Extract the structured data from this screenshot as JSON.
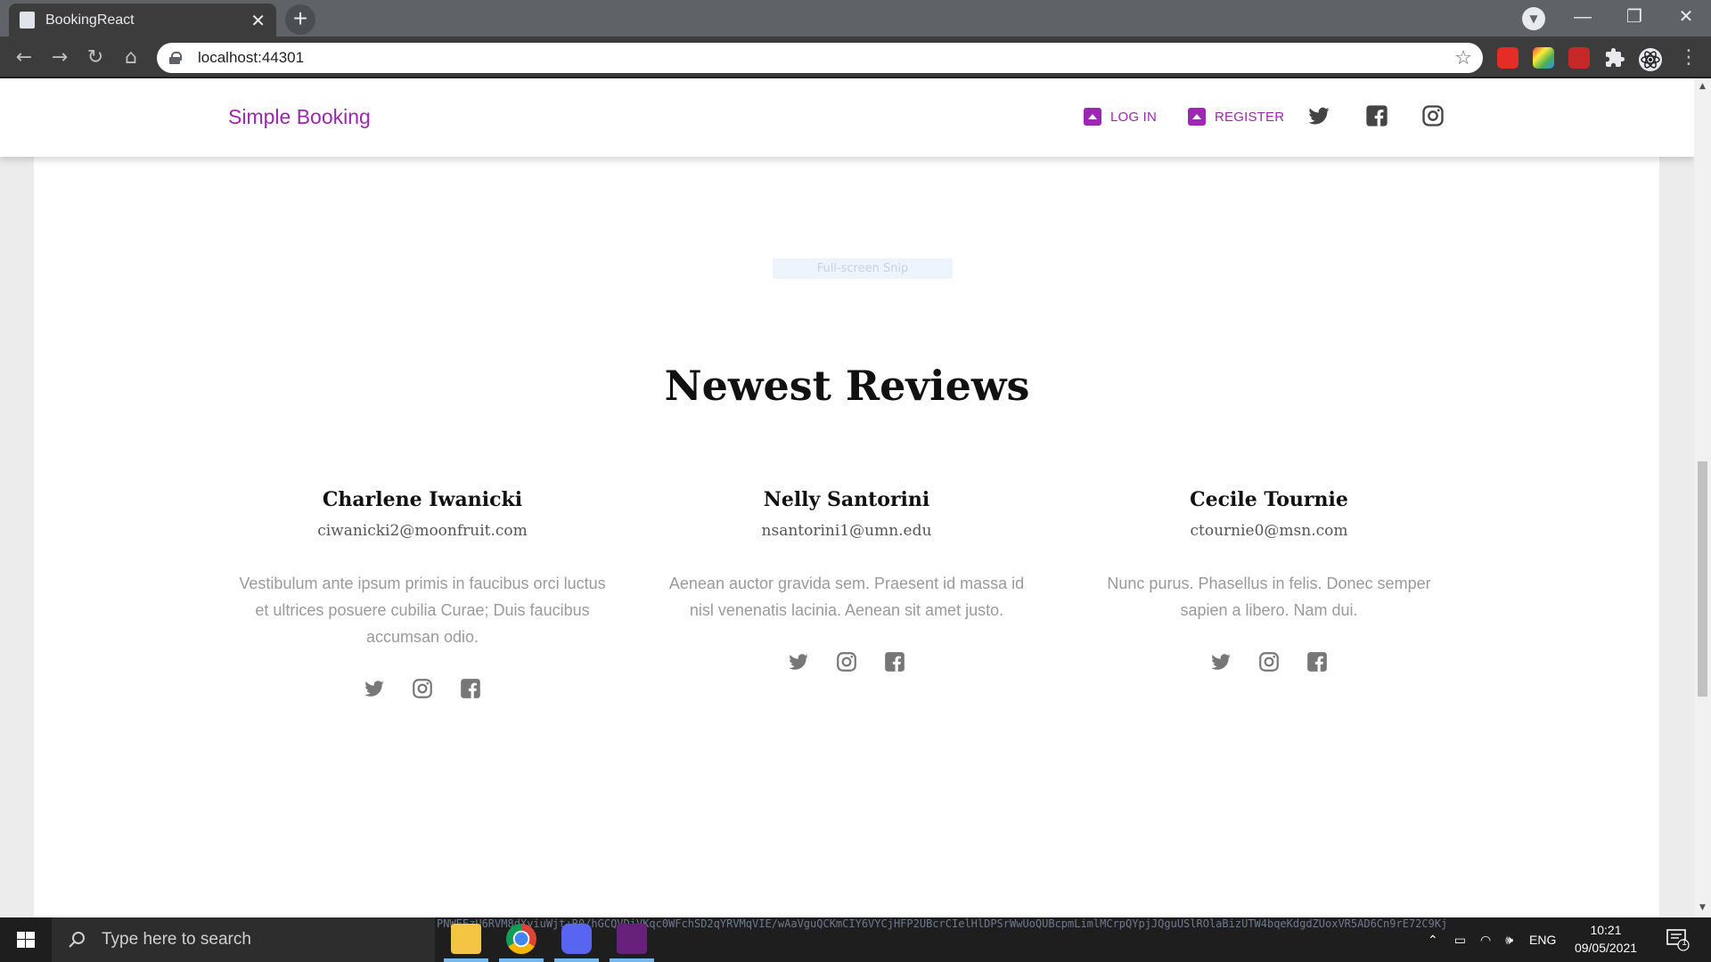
{
  "browser": {
    "tab_title": "BookingReact",
    "tab_close": "✕",
    "new_tab": "+",
    "url": "localhost:44301",
    "window_minimize": "—",
    "window_restore": "❐",
    "window_close": "✕"
  },
  "site": {
    "brand": "Simple Booking",
    "nav": {
      "login_label": "LOG IN",
      "register_label": "REGISTER"
    },
    "overlay_hint": "Full-screen Snip",
    "section_title": "Newest Reviews",
    "reviews": [
      {
        "name": "Charlene Iwanicki",
        "email": "ciwanicki2@moonfruit.com",
        "text": "Vestibulum ante ipsum primis in faucibus orci luctus et ultrices posuere cubilia Curae; Duis faucibus accumsan odio."
      },
      {
        "name": "Nelly Santorini",
        "email": "nsantorini1@umn.edu",
        "text": "Aenean auctor gravida sem. Praesent id massa id nisl venenatis lacinia. Aenean sit amet justo."
      },
      {
        "name": "Cecile Tournie",
        "email": "ctournie0@msn.com",
        "text": "Nunc purus. Phasellus in felis. Donec semper sapien a libero. Nam dui."
      }
    ]
  },
  "taskbar": {
    "search_placeholder": "Type here to search",
    "background_text": "PNWEEzU6RVM8dXyiuWjt+R0/hGCQVDiVKqc0WFchSD2qYRVMqVIE/wAaVguQCKmCIY6VYCjHFP2UBcrCIelHlDPSrWwUoQUBcpmLimlMCrpQYpjJQguUSlROlaBizUTW4bqeKdgdZUoxVR5AD6Cn9rE72C9Kj",
    "language": "ENG",
    "time": "10:21",
    "date": "09/05/2021",
    "notification_count": "1"
  },
  "colors": {
    "brand_purple": "#9c27b0",
    "taskbar_bg": "#1e1e1e",
    "chrome_dark": "#3c3c3c"
  }
}
